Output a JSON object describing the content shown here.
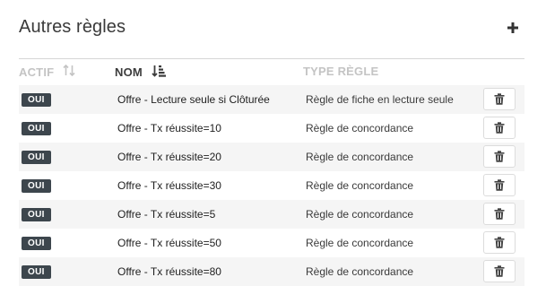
{
  "panel": {
    "title": "Autres règles",
    "add_icon": "plus-icon"
  },
  "table": {
    "columns": {
      "actif": "ACTIF",
      "nom": "NOM",
      "type": "TYPE RÈGLE"
    },
    "sort_icons": {
      "actif": "sort-arrows-icon",
      "nom": "sort-alpha-desc-icon"
    },
    "rows": [
      {
        "actif": "OUI",
        "nom": "Offre - Lecture seule si Clôturée",
        "type": "Règle de fiche en lecture seule"
      },
      {
        "actif": "OUI",
        "nom": "Offre - Tx réussite=10",
        "type": "Règle de concordance"
      },
      {
        "actif": "OUI",
        "nom": "Offre - Tx réussite=20",
        "type": "Règle de concordance"
      },
      {
        "actif": "OUI",
        "nom": "Offre - Tx réussite=30",
        "type": "Règle de concordance"
      },
      {
        "actif": "OUI",
        "nom": "Offre - Tx réussite=5",
        "type": "Règle de concordance"
      },
      {
        "actif": "OUI",
        "nom": "Offre - Tx réussite=50",
        "type": "Règle de concordance"
      },
      {
        "actif": "OUI",
        "nom": "Offre - Tx réussite=80",
        "type": "Règle de concordance"
      }
    ],
    "delete_icon": "trash-icon"
  },
  "colors": {
    "badge_bg": "#3d464d",
    "row_alt": "#f5f5f5",
    "header_muted": "#c4c4c4"
  }
}
